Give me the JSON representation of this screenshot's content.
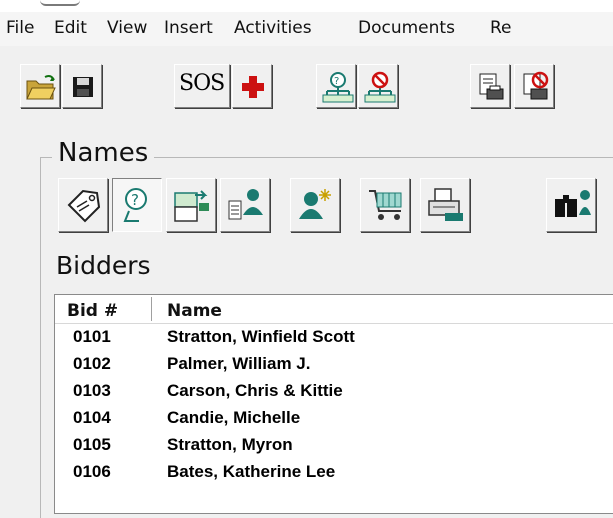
{
  "menu": {
    "items": [
      "File",
      "Edit",
      "View",
      "Insert",
      "Activities",
      "Documents",
      "Re"
    ]
  },
  "toolbar": {
    "sos_label": "SOS",
    "buttons": [
      {
        "icon": "open-folder-icon"
      },
      {
        "icon": "save-disk-icon"
      },
      {
        "icon": "sos-button"
      },
      {
        "icon": "red-cross-icon"
      },
      {
        "icon": "bidder-network-icon"
      },
      {
        "icon": "no-bidder-network-icon"
      },
      {
        "icon": "print-document-icon"
      },
      {
        "icon": "no-print-document-icon"
      }
    ]
  },
  "names_group": {
    "title": "Names",
    "buttons": [
      {
        "icon": "tag-icon"
      },
      {
        "icon": "bidder-number-icon"
      },
      {
        "icon": "card-transfer-icon"
      },
      {
        "icon": "person-list-icon"
      },
      {
        "icon": "new-person-icon"
      },
      {
        "icon": "shopping-cart-icon"
      },
      {
        "icon": "register-icon"
      },
      {
        "icon": "binoculars-icon"
      }
    ]
  },
  "bidders": {
    "label": "Bidders",
    "columns": [
      "Bid #",
      "Name"
    ],
    "rows": [
      {
        "bid": "0101",
        "name": "Stratton, Winfield Scott"
      },
      {
        "bid": "0102",
        "name": "Palmer, William J."
      },
      {
        "bid": "0103",
        "name": "Carson, Chris & Kittie"
      },
      {
        "bid": "0104",
        "name": "Candie, Michelle"
      },
      {
        "bid": "0105",
        "name": "Stratton, Myron"
      },
      {
        "bid": "0106",
        "name": "Bates, Katherine Lee"
      }
    ]
  },
  "colors": {
    "accent_red": "#cc1111",
    "accent_teal": "#1a7a70",
    "window_bg": "#f0f0f0"
  }
}
